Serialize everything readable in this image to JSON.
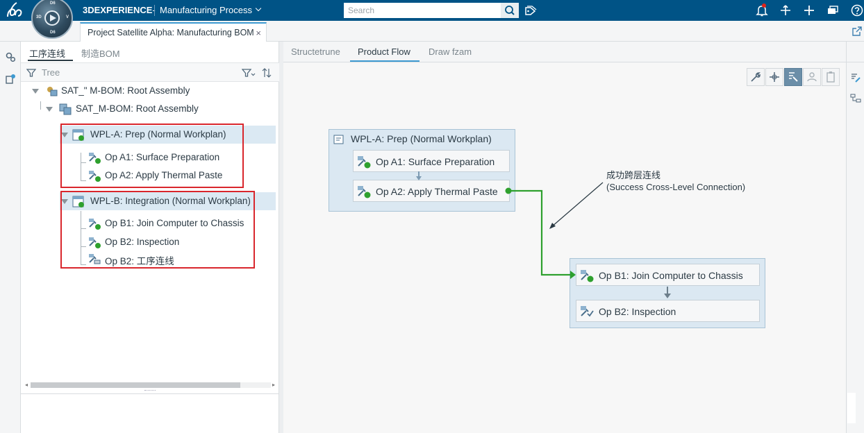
{
  "topbar": {
    "brand": "3DEXPERIENCE",
    "separator": "-",
    "module": "Manufacturing Process",
    "search_placeholder": "Search",
    "compass_labels": [
      "3D",
      "V",
      "i",
      "R",
      "D6"
    ]
  },
  "doc_tab": {
    "title": "Project Satellite Alpha: Manufacturing BOM",
    "close": "×"
  },
  "tree_panel": {
    "tabs": [
      {
        "label": "工序连线",
        "active": true
      },
      {
        "label": "制造BOM",
        "active": false
      }
    ],
    "toolbar_label": "Tree",
    "rows": [
      {
        "label": "SAT_\" M-BOM: Root Assembly"
      },
      {
        "label": "SAT_M-BOM: Root Assembly"
      },
      {
        "label": "WPL-A: Prep (Normal Workplan)"
      },
      {
        "label": "Op A1: Surface Preparation"
      },
      {
        "label": "Op A2: Apply Thermal Paste"
      },
      {
        "label": "WPL-B: Integration (Normal Workplan)"
      },
      {
        "label": "Op B1: Join Computer to Chassis"
      },
      {
        "label": "Op B2: Inspection"
      },
      {
        "label": "Op B2: 工序连线"
      }
    ]
  },
  "canvas": {
    "tabs": [
      {
        "label": "Structetrune",
        "active": false
      },
      {
        "label": "Product Flow",
        "active": true
      },
      {
        "label": "Draw fzam",
        "active": false
      }
    ],
    "workplan_a": {
      "title": "WPL-A: Prep (Normal Workplan)",
      "ops": [
        "Op A1: Surface Preparation",
        "Op A2: Apply Thermal Paste"
      ]
    },
    "workplan_b": {
      "ops": [
        "Op B1: Join Computer to Chassis",
        "Op B2: Inspection"
      ]
    },
    "annotation": {
      "line1": "成功跨层连线",
      "line2": "(Success Cross-Level Connection)"
    }
  },
  "colors": {
    "topbar": "#005386",
    "accent": "#3d9ad1",
    "connection": "#2ea02e",
    "highlight_box": "#d9262c",
    "workplan_fill": "#dbe8f2"
  },
  "icons": [
    "3ds-logo-icon",
    "compass-icon",
    "search-icon",
    "tag-icon",
    "notification-icon",
    "share-icon",
    "add-icon",
    "apps-icon",
    "help-icon",
    "export-icon",
    "filter-icon",
    "sort-icon",
    "wrench-icon",
    "move-icon",
    "select-icon",
    "group-icon",
    "clipboard-icon"
  ]
}
